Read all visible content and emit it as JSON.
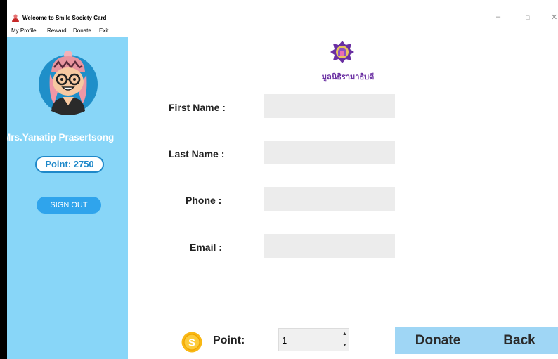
{
  "window": {
    "title": "Welcome to Smile Society Card",
    "minimize_glyph": "–",
    "maximize_glyph": "□",
    "close_glyph": "✕"
  },
  "menu": [
    "My Profile",
    "Reward",
    "Donate",
    "Exit"
  ],
  "sidebar": {
    "user_name": "Mrs.Yanatip Prasertsong",
    "point_badge": "Point: 2750",
    "sign_out": "SIGN OUT"
  },
  "organization": {
    "name": "มูลนิธิรามาธิบดี"
  },
  "form": {
    "first_name_label": "First Name :",
    "last_name_label": "Last Name :",
    "phone_label": "Phone :",
    "email_label": "Email :",
    "first_name_value": "",
    "last_name_value": "",
    "phone_value": "",
    "email_value": ""
  },
  "points": {
    "label": "Point:",
    "value": "1",
    "coin_letter": "S"
  },
  "actions": {
    "donate": "Donate",
    "back": "Back"
  },
  "icons": {
    "app": "person-icon",
    "coin": "coin-icon",
    "logo": "foundation-logo-icon"
  },
  "colors": {
    "sidebar": "#88d6f8",
    "action_bar": "#9fd6f5",
    "sign_out": "#2fa4ec",
    "accent": "#1e88c9",
    "coin": "#f9b814",
    "logo": "#6a2fa2"
  }
}
